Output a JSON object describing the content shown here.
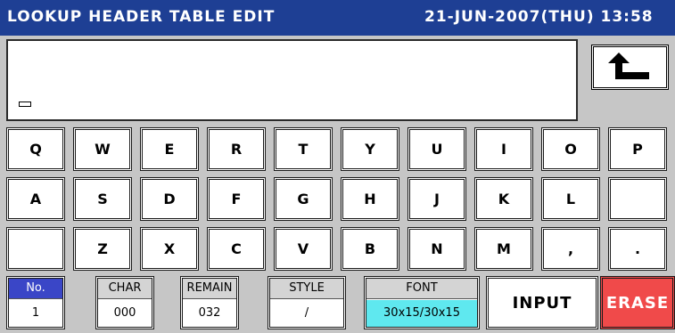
{
  "header": {
    "title": "LOOKUP HEADER TABLE EDIT",
    "datetime": "21-JUN-2007(THU) 13:58"
  },
  "editor": {
    "back_icon": "return-arrow-icon"
  },
  "keyboard": {
    "row1": [
      "Q",
      "W",
      "E",
      "R",
      "T",
      "Y",
      "U",
      "I",
      "O",
      "P"
    ],
    "row2": [
      "A",
      "S",
      "D",
      "F",
      "G",
      "H",
      "J",
      "K",
      "L",
      ""
    ],
    "row3": [
      "",
      "Z",
      "X",
      "C",
      "V",
      "B",
      "N",
      "M",
      ",",
      "."
    ]
  },
  "status": {
    "no": {
      "label": "No.",
      "value": "1"
    },
    "char": {
      "label": "CHAR",
      "value": "000"
    },
    "remain": {
      "label": "REMAIN",
      "value": "032"
    },
    "style": {
      "label": "STYLE",
      "value": "/"
    },
    "font": {
      "label": "FONT",
      "value": "30x15/30x15"
    }
  },
  "actions": {
    "input_label": "INPUT",
    "erase_label": "ERASE"
  },
  "colors": {
    "title_bg": "#1e3f94",
    "selected_field": "#3a46c7",
    "font_value_bg": "#5fe8ef",
    "erase_bg": "#f04a4a"
  }
}
